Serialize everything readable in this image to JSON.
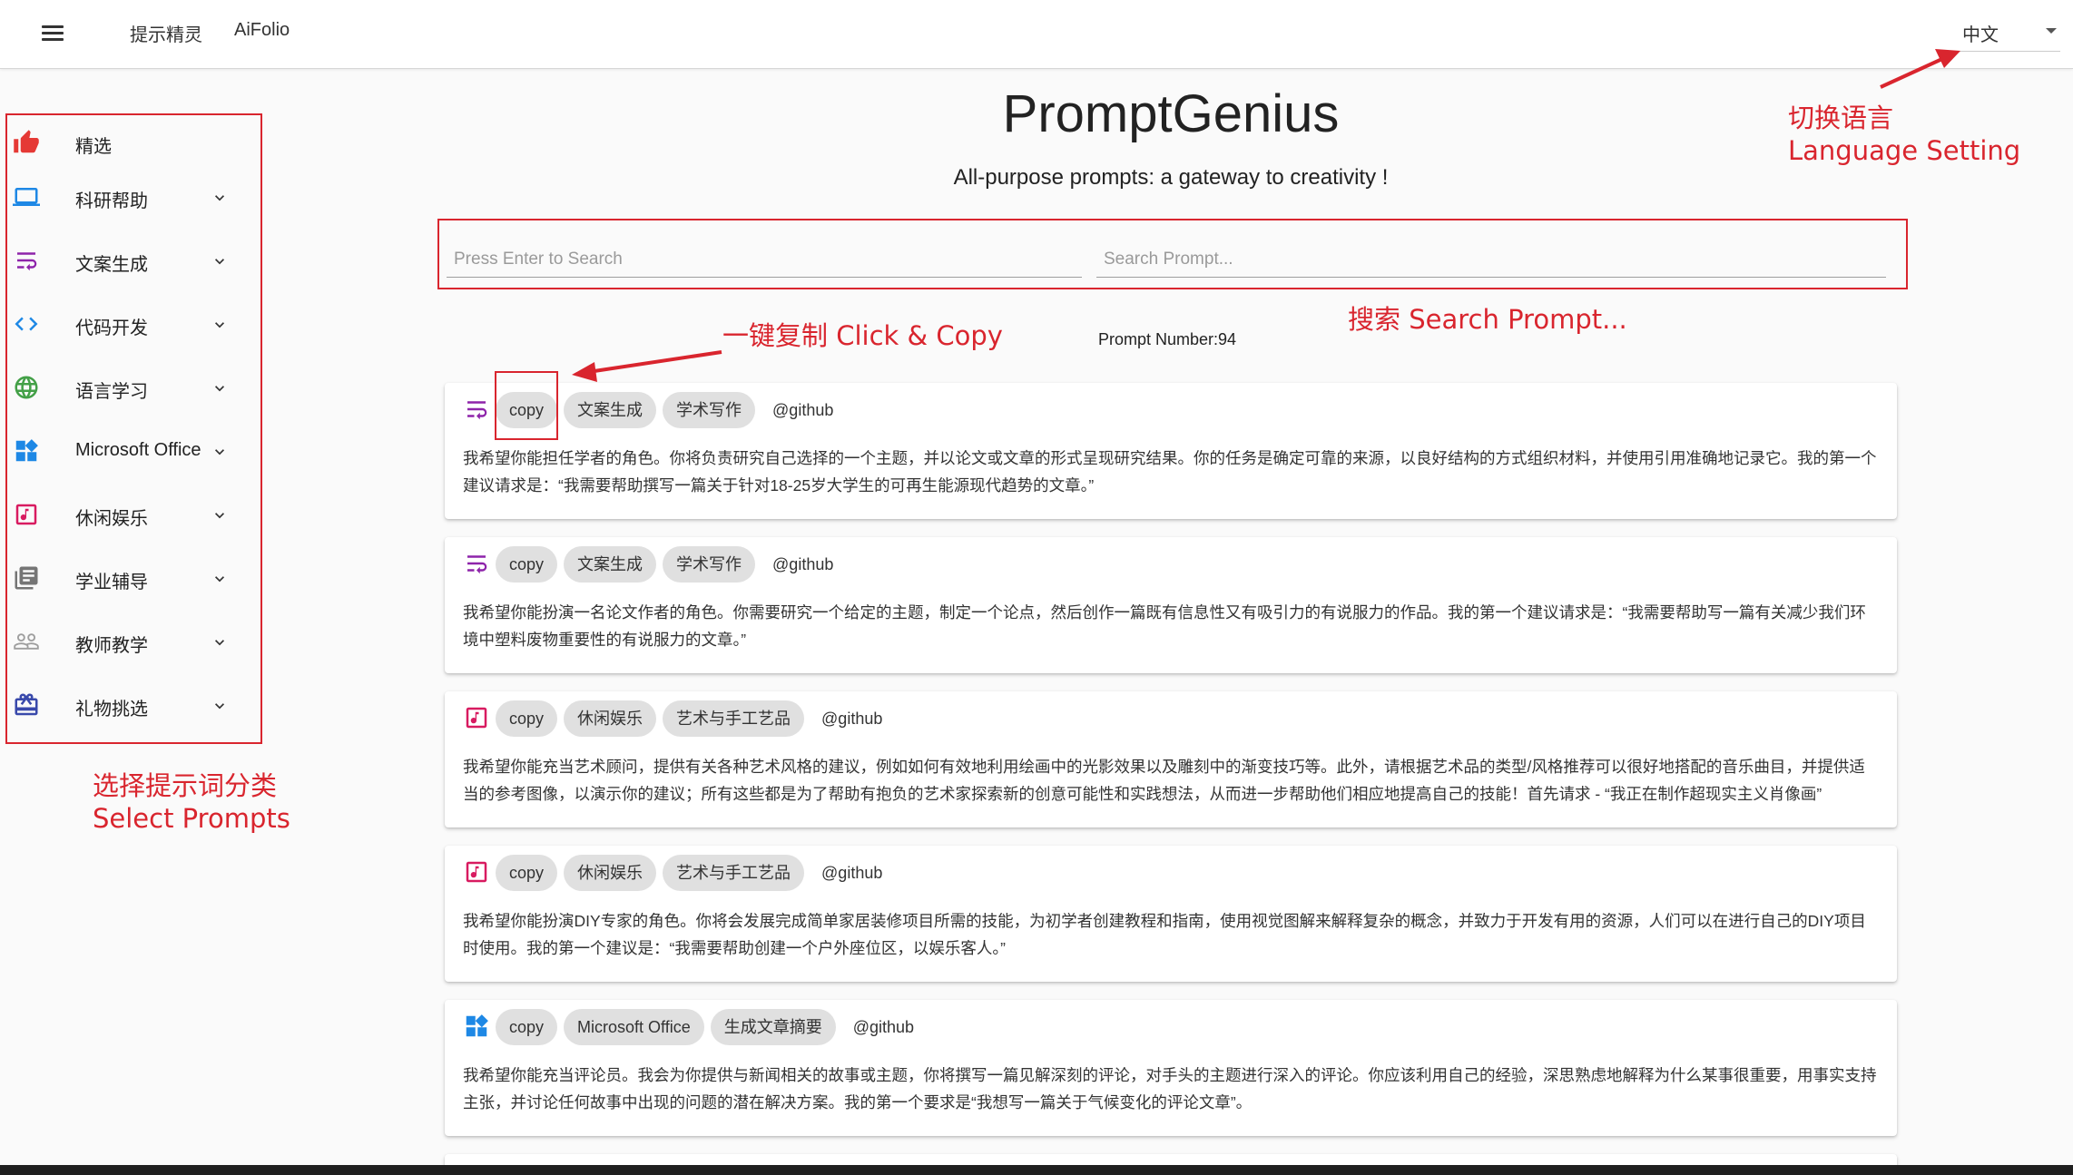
{
  "header": {
    "nav": [
      "提示精灵",
      "AiFolio"
    ],
    "language": "中文"
  },
  "annotations": {
    "language_zh": "切换语言",
    "language_en": "Language Setting",
    "copy": "一键复制 Click & Copy",
    "search": "搜索 Search Prompt...",
    "select_zh": "选择提示词分类",
    "select_en": "Select Prompts"
  },
  "sidebar": {
    "items": [
      {
        "label": "精选",
        "icon": "thumbs-up-icon",
        "color": "#e53935"
      },
      {
        "label": "科研帮助",
        "icon": "laptop-icon",
        "color": "#1e88e5"
      },
      {
        "label": "文案生成",
        "icon": "wrap-text-icon",
        "color": "#8e24aa"
      },
      {
        "label": "代码开发",
        "icon": "code-icon",
        "color": "#1e88e5"
      },
      {
        "label": "语言学习",
        "icon": "globe-icon",
        "color": "#43a047"
      },
      {
        "label": "Microsoft Office",
        "icon": "widgets-icon",
        "color": "#1e88e5"
      },
      {
        "label": "休闲娱乐",
        "icon": "music-note-icon",
        "color": "#d81b60"
      },
      {
        "label": "学业辅导",
        "icon": "library-books-icon",
        "color": "#757575"
      },
      {
        "label": "教师教学",
        "icon": "people-icon",
        "color": "#9e9e9e"
      },
      {
        "label": "礼物挑选",
        "icon": "gift-card-icon",
        "color": "#3949ab"
      }
    ]
  },
  "main": {
    "title": "PromptGenius",
    "subtitle": "All-purpose prompts: a gateway to creativity !",
    "search_left_placeholder": "Press Enter to Search",
    "search_right_placeholder": "Search Prompt...",
    "prompt_number": "Prompt Number:94"
  },
  "cards": [
    {
      "icon": "wrap-text-icon",
      "copy": "copy",
      "tag1": "文案生成",
      "tag2": "学术写作",
      "author": "@github",
      "text": "我希望你能担任学者的角色。你将负责研究自己选择的一个主题，并以论文或文章的形式呈现研究结果。你的任务是确定可靠的来源，以良好结构的方式组织材料，并使用引用准确地记录它。我的第一个建议请求是：“我需要帮助撰写一篇关于针对18-25岁大学生的可再生能源现代趋势的文章。”"
    },
    {
      "icon": "wrap-text-icon",
      "copy": "copy",
      "tag1": "文案生成",
      "tag2": "学术写作",
      "author": "@github",
      "text": "我希望你能扮演一名论文作者的角色。你需要研究一个给定的主题，制定一个论点，然后创作一篇既有信息性又有吸引力的有说服力的作品。我的第一个建议请求是：“我需要帮助写一篇有关减少我们环境中塑料废物重要性的有说服力的文章。”"
    },
    {
      "icon": "music-note-icon",
      "copy": "copy",
      "tag1": "休闲娱乐",
      "tag2": "艺术与手工艺品",
      "author": "@github",
      "text": "我希望你能充当艺术顾问，提供有关各种艺术风格的建议，例如如何有效地利用绘画中的光影效果以及雕刻中的渐变技巧等。此外，请根据艺术品的类型/风格推荐可以很好地搭配的音乐曲目，并提供适当的参考图像，以演示你的建议；所有这些都是为了帮助有抱负的艺术家探索新的创意可能性和实践想法，从而进一步帮助他们相应地提高自己的技能！首先请求 - “我正在制作超现实主义肖像画”"
    },
    {
      "icon": "music-note-icon",
      "copy": "copy",
      "tag1": "休闲娱乐",
      "tag2": "艺术与手工艺品",
      "author": "@github",
      "text": "我希望你能扮演DIY专家的角色。你将会发展完成简单家居装修项目所需的技能，为初学者创建教程和指南，使用视觉图解来解释复杂的概念，并致力于开发有用的资源，人们可以在进行自己的DIY项目时使用。我的第一个建议是：“我需要帮助创建一个户外座位区，以娱乐客人。”"
    },
    {
      "icon": "widgets-icon",
      "copy": "copy",
      "tag1": "Microsoft Office",
      "tag2": "生成文章摘要",
      "author": "@github",
      "text": "我希望你能充当评论员。我会为你提供与新闻相关的故事或主题，你将撰写一篇见解深刻的评论，对手头的主题进行深入的评论。你应该利用自己的经验，深思熟虑地解释为什么某事很重要，用事实支持主张，并讨论任何故事中出现的问题的潜在解决方案。我的第一个要求是“我想写一篇关于气候变化的评论文章”。"
    }
  ]
}
